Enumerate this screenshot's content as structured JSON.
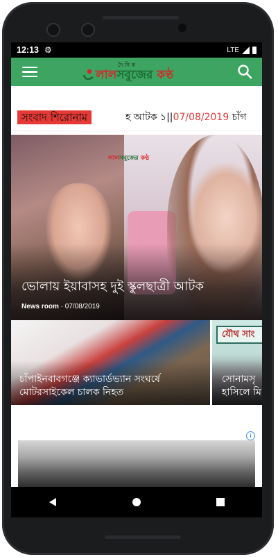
{
  "status_bar": {
    "time": "12:13",
    "network": "LTE"
  },
  "app_bar": {
    "logo_small": "দৈ নি ক",
    "logo_red": "লাল",
    "logo_green": "সবুজের",
    "logo_red2": " কণ্ঠ"
  },
  "ticker": {
    "label": "সংবাদ শিরোনাম",
    "text": "হ আটক ১||",
    "date": "07/08/2019",
    "tail": " চাঁগ"
  },
  "hero": {
    "brand_red": "লাল",
    "brand_green": "সবুজের",
    "brand_red2": " কণ্ঠ",
    "title": "ভোলায় ইয়াবাসহ দুই স্কুলছাত্রী আটক",
    "author": "News room",
    "date": "07/08/2019"
  },
  "cards": [
    {
      "title": "চাঁপাইনবাবগঞ্জে ক্যাভার্ডভ্যান সংঘর্ষে মোটরসাইকেল চালক নিহত"
    },
    {
      "title": "সোনামসৃ হাসিলে মি",
      "banner": "যৌথ সাং"
    }
  ],
  "ad": {
    "info": "i"
  },
  "colors": {
    "appbar": "#3da561",
    "ticker_label": "#e53935",
    "date": "#e53935"
  }
}
